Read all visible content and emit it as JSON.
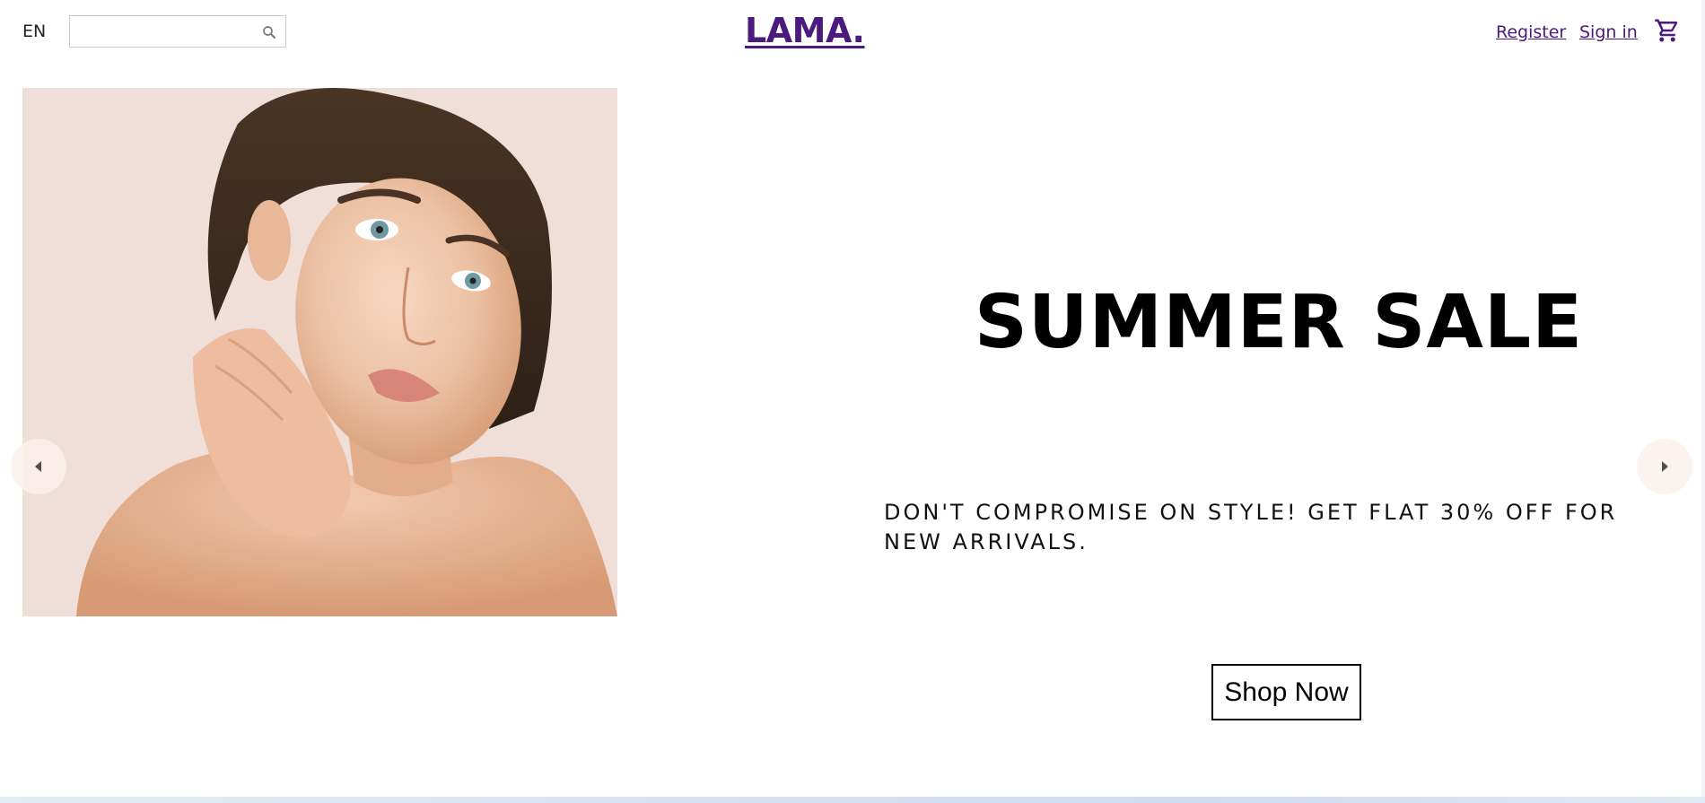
{
  "navbar": {
    "language": "EN",
    "search": {
      "value": "",
      "placeholder": ""
    },
    "logo": "LAMA.",
    "links": {
      "register": "Register",
      "sign_in": "Sign in"
    },
    "icons": {
      "search": "search-icon",
      "cart": "shopping-cart-icon"
    }
  },
  "slider": {
    "current_slide": {
      "title": "SUMMER SALE",
      "description": "DON'T COMPROMISE ON STYLE! GET FLAT 30% OFF FOR NEW ARRIVALS.",
      "button_label": "Shop Now",
      "image": "woman-portrait-photo"
    },
    "arrows": {
      "left": "arrow-left-icon",
      "right": "arrow-right-icon"
    }
  },
  "colors": {
    "brand": "#4a1a7f",
    "slide_background": "#efdfd8"
  }
}
